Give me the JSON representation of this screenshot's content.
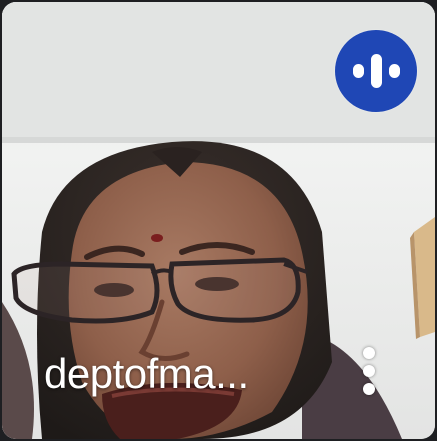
{
  "participant": {
    "name": "deptofma..."
  },
  "icons": {
    "speaking": "audio-wave-icon",
    "more": "more-vert-icon"
  },
  "colors": {
    "speaking_indicator": "#1f47b5",
    "name_text": "#ffffff"
  }
}
